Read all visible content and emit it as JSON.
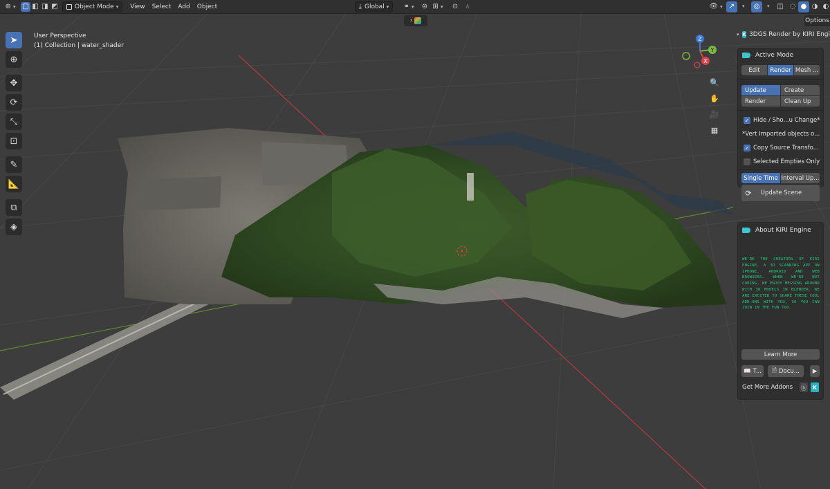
{
  "header": {
    "mode_label": "Object Mode",
    "menus": [
      "View",
      "Select",
      "Add",
      "Object"
    ],
    "orientation_label": "Global"
  },
  "viewport": {
    "view_name": "User Perspective",
    "collection_info": "(1) Collection | water_shader"
  },
  "options_label": "Options",
  "gizmo": {
    "x_label": "X",
    "y_label": "Y",
    "z_label": "Z"
  },
  "panel": {
    "title": "3DGS Render by KIRI Engi",
    "active_mode": {
      "heading": "Active Mode",
      "tabs": [
        "Edit",
        "Render",
        "Mesh ..."
      ],
      "selected_tab": "Render"
    },
    "actions": [
      "Update",
      "Create",
      "Render",
      "Clean Up"
    ],
    "selected_action": "Update",
    "options": {
      "hide_show": "Hide / Sho...u Change*",
      "vert_note": "*Vert Imported objects o...",
      "copy_source": "Copy Source Transfo...",
      "selected_empties": "Selected Empties Only"
    },
    "timing_tabs": [
      "Single Time",
      "Interval Up..."
    ],
    "selected_timing": "Single Time",
    "update_scene": "Update Scene",
    "about": {
      "heading": "About KIRI Engine",
      "text": "We're the creators of KIRI Engine, a 3D scanning app on iPhone, Android and web browsers. When we're not coding, we enjoy messing around with 3D models in Blender. We are excited to share these cool add-ons with you, so you can join in the fun too.",
      "learn_more": "Learn More",
      "tutorial_btn": "T...",
      "docs_btn": "Docu...",
      "get_more": "Get More Addons"
    }
  },
  "colors": {
    "accent": "#4772b3",
    "kiri_teal": "#3ec5d0",
    "about_text": "#1fd07c",
    "axis_x": "#d9434a",
    "axis_y": "#7ab844",
    "axis_z": "#3f78d6"
  }
}
